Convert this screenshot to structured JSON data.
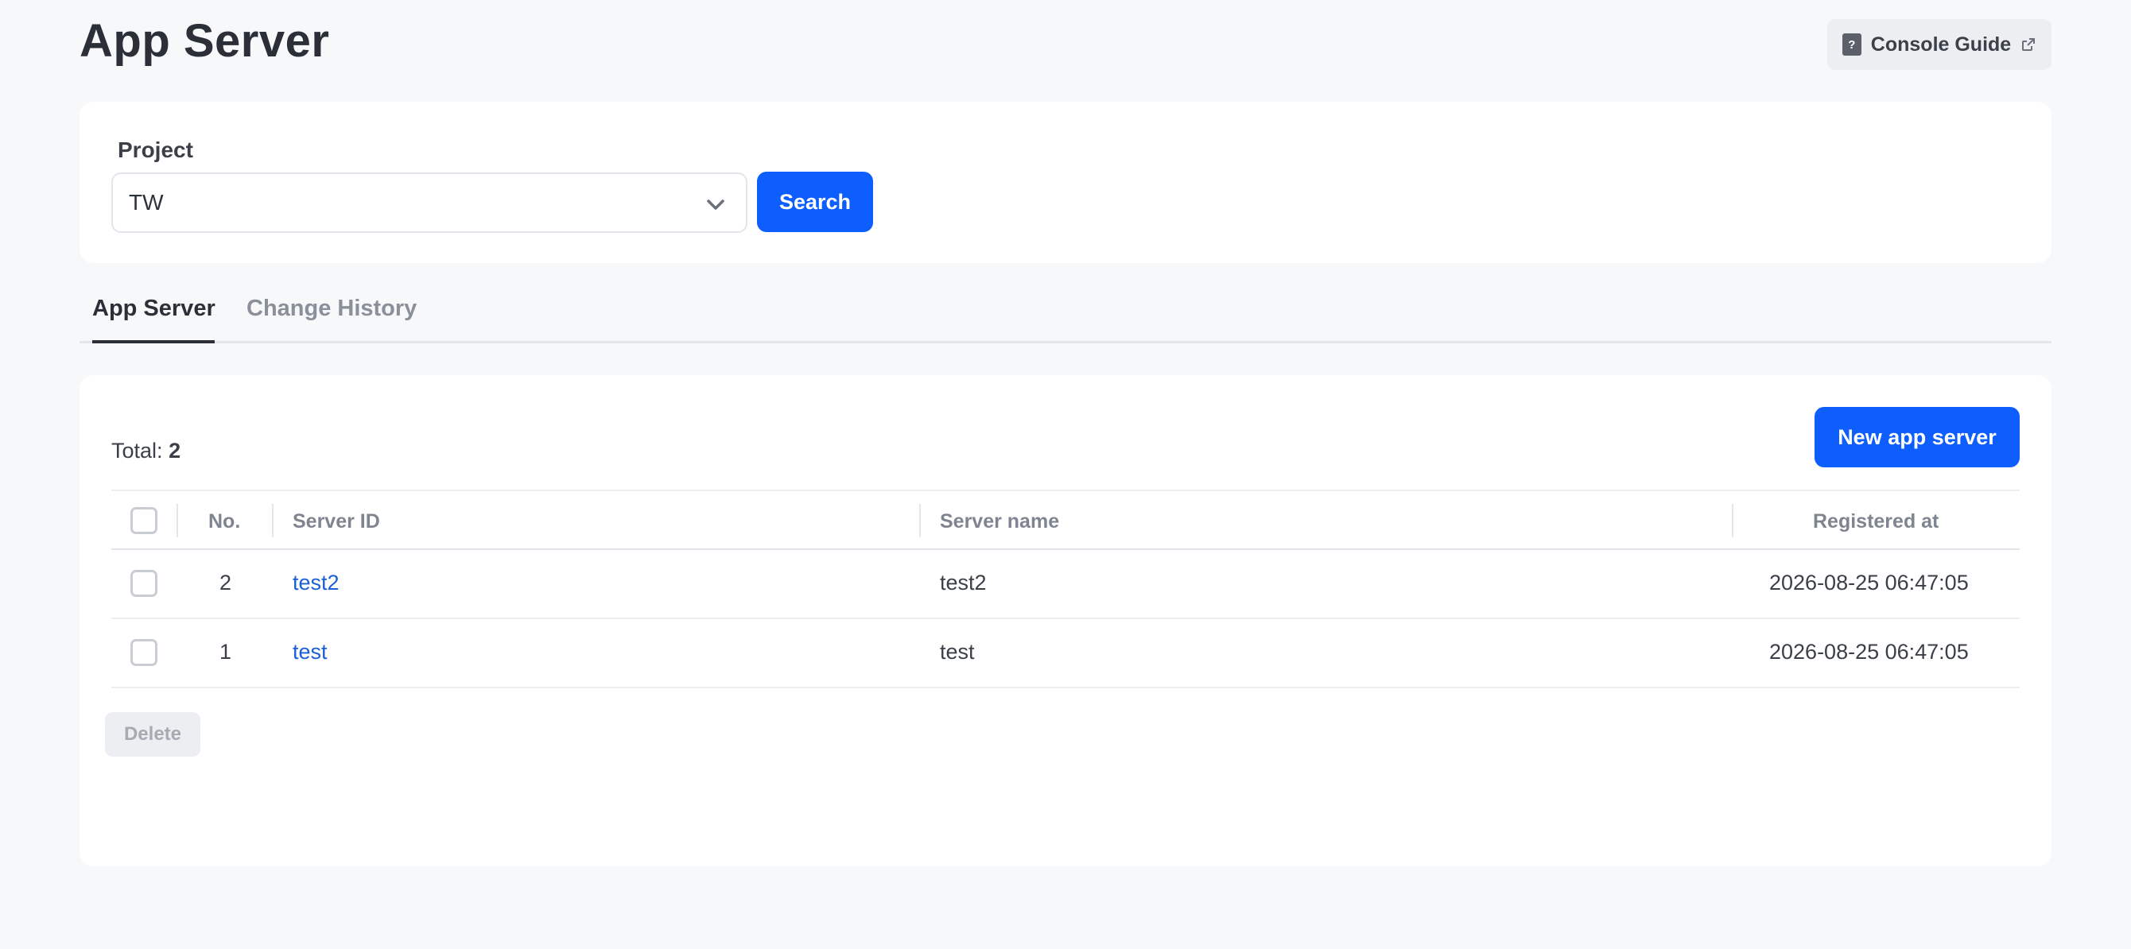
{
  "page": {
    "title": "App Server"
  },
  "header": {
    "guide_label": "Console Guide",
    "guide_icon": "document-help-icon",
    "external_icon": "external-link-icon"
  },
  "search": {
    "project_label": "Project",
    "project_value": "TW",
    "search_label": "Search"
  },
  "tabs": [
    {
      "label": "App Server",
      "active": true
    },
    {
      "label": "Change History",
      "active": false
    }
  ],
  "list": {
    "total_label": "Total:",
    "total_count": "2",
    "new_button_label": "New app server",
    "columns": {
      "no": "No.",
      "server_id": "Server ID",
      "server_name": "Server name",
      "registered_at": "Registered at"
    },
    "rows": [
      {
        "no": "2",
        "server_id": "test2",
        "server_name": "test2",
        "registered_at": "2026-08-25 06:47:05"
      },
      {
        "no": "1",
        "server_id": "test",
        "server_name": "test",
        "registered_at": "2026-08-25 06:47:05"
      }
    ],
    "delete_label": "Delete"
  },
  "colors": {
    "accent": "#0d5efc",
    "link": "#1a5fd6",
    "background": "#f7f8fa"
  }
}
